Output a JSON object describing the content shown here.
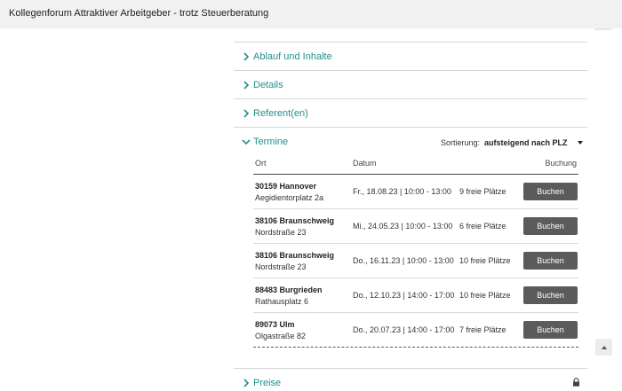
{
  "window": {
    "title": "Kollegenforum Attraktiver Arbeitgeber - trotz Steuerberatung"
  },
  "accordion": {
    "items": [
      {
        "label": "Ablauf und Inhalte",
        "expanded": false
      },
      {
        "label": "Details",
        "expanded": false
      },
      {
        "label": "Referent(en)",
        "expanded": false
      },
      {
        "label": "Termine",
        "expanded": true
      },
      {
        "label": "Preise",
        "expanded": false
      }
    ]
  },
  "sorting": {
    "label": "Sortierung:",
    "value": "aufsteigend nach PLZ"
  },
  "table": {
    "columns": {
      "ort": "Ort",
      "datum": "Datum",
      "buchung": "Buchung"
    },
    "rows": [
      {
        "location": "30159 Hannover",
        "street": "Aegidientorplatz 2a",
        "date": "Fr., 18.08.23 | 10:00 - 13:00",
        "free": "9 freie Plätze",
        "button": "Buchen"
      },
      {
        "location": "38106 Braunschweig",
        "street": "Nordstraße 23",
        "date": "Mi., 24.05.23 | 10:00 - 13:00",
        "free": "6 freie Plätze",
        "button": "Buchen"
      },
      {
        "location": "38106 Braunschweig",
        "street": "Nordstraße 23",
        "date": "Do., 16.11.23 | 10:00 - 13:00",
        "free": "10 freie Plätze",
        "button": "Buchen"
      },
      {
        "location": "88483 Burgrieden",
        "street": "Rathausplatz 6",
        "date": "Do., 12.10.23 | 14:00 - 17:00",
        "free": "10 freie Plätze",
        "button": "Buchen"
      },
      {
        "location": "89073 Ulm",
        "street": "Olgastraße 82",
        "date": "Do., 20.07.23 | 14:00 - 17:00",
        "free": "7 freie Plätze",
        "button": "Buchen"
      }
    ]
  },
  "icons": {
    "chevron": "chevron-right-icon",
    "chevron_open": "chevron-down-icon",
    "lock": "lock-icon",
    "scroll_up": "arrow-up-icon"
  },
  "colors": {
    "accent": "#1f8f8d",
    "button": "#5b5b5b",
    "topbar": "#f1f1f1"
  }
}
